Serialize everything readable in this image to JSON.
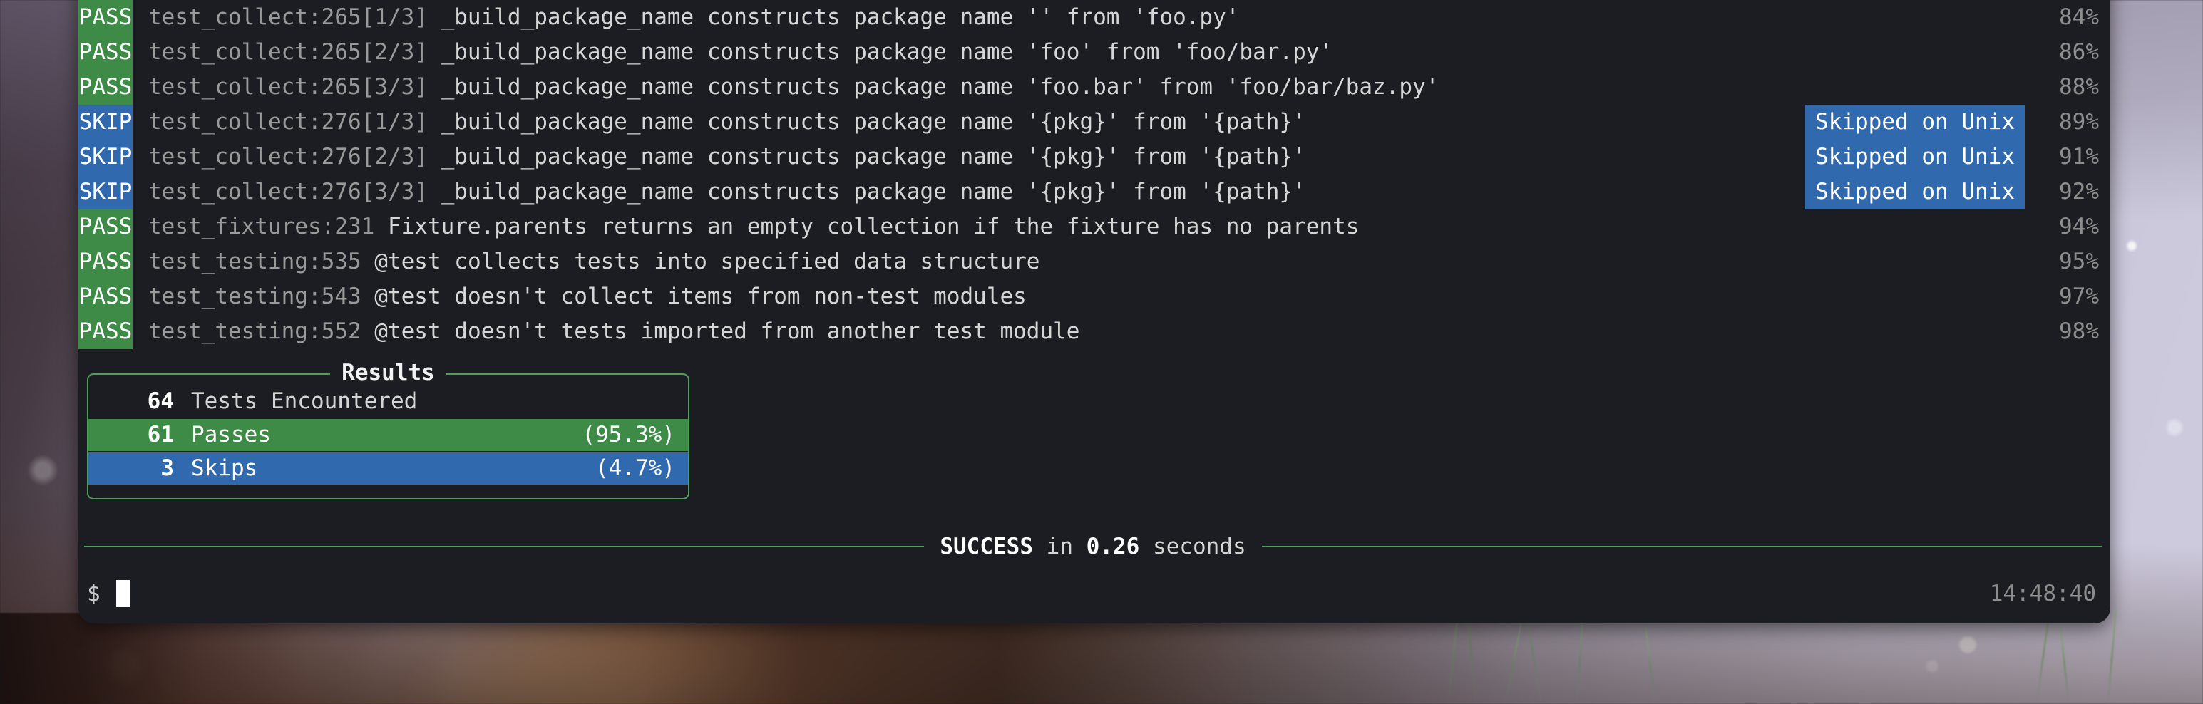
{
  "wallpaper": {
    "description": "blurred snowy landscape with warm firelight"
  },
  "terminal": {
    "rows": [
      {
        "status": "PASS",
        "id": "test_collect:265[1/3]",
        "desc": "_build_package_name constructs package name '' from 'foo.py'",
        "note": "",
        "pct": "84%"
      },
      {
        "status": "PASS",
        "id": "test_collect:265[2/3]",
        "desc": "_build_package_name constructs package name 'foo' from 'foo/bar.py'",
        "note": "",
        "pct": "86%"
      },
      {
        "status": "PASS",
        "id": "test_collect:265[3/3]",
        "desc": "_build_package_name constructs package name 'foo.bar' from 'foo/bar/baz.py'",
        "note": "",
        "pct": "88%"
      },
      {
        "status": "SKIP",
        "id": "test_collect:276[1/3]",
        "desc": "_build_package_name constructs package name '{pkg}' from '{path}'",
        "note": "Skipped on Unix",
        "pct": "89%"
      },
      {
        "status": "SKIP",
        "id": "test_collect:276[2/3]",
        "desc": "_build_package_name constructs package name '{pkg}' from '{path}'",
        "note": "Skipped on Unix",
        "pct": "91%"
      },
      {
        "status": "SKIP",
        "id": "test_collect:276[3/3]",
        "desc": "_build_package_name constructs package name '{pkg}' from '{path}'",
        "note": "Skipped on Unix",
        "pct": "92%"
      },
      {
        "status": "PASS",
        "id": "test_fixtures:231",
        "desc": "Fixture.parents returns an empty collection if the fixture has no parents",
        "note": "",
        "pct": "94%"
      },
      {
        "status": "PASS",
        "id": "test_testing:535",
        "desc": "@test collects tests into specified data structure",
        "note": "",
        "pct": "95%"
      },
      {
        "status": "PASS",
        "id": "test_testing:543",
        "desc": "@test doesn't collect items from non-test modules",
        "note": "",
        "pct": "97%"
      },
      {
        "status": "PASS",
        "id": "test_testing:552",
        "desc": "@test doesn't tests imported from another test module",
        "note": "",
        "pct": "98%"
      }
    ],
    "results": {
      "title": "Results",
      "lines": [
        {
          "count": "64",
          "label": "Tests Encountered",
          "percent": "",
          "kind": "total"
        },
        {
          "count": "61",
          "label": "Passes",
          "percent": "(95.3%)",
          "kind": "pass"
        },
        {
          "count": "3",
          "label": "Skips",
          "percent": "(4.7%)",
          "kind": "skip"
        }
      ]
    },
    "summary": {
      "status": "SUCCESS",
      "connector": "in",
      "duration": "0.26",
      "unit": "seconds"
    },
    "prompt": {
      "symbol": "$",
      "input": "",
      "clock": "14:48:40"
    }
  },
  "colors": {
    "pass_green": "#3d8b46",
    "skip_blue": "#3069ad",
    "border_green": "#4f9e5c",
    "terminal_bg": "#1b1d22",
    "dim_text": "#8d8d8d"
  }
}
